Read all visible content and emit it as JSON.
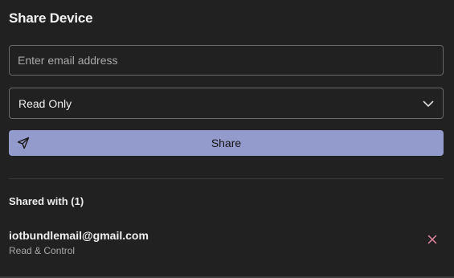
{
  "dialog": {
    "title": "Share Device"
  },
  "email_input": {
    "placeholder": "Enter email address",
    "value": ""
  },
  "permission_select": {
    "selected": "Read Only",
    "icon": "chevron-down-icon"
  },
  "share_button": {
    "label": "Share",
    "icon": "send-icon",
    "color": "#939bcd"
  },
  "shared_section": {
    "heading": "Shared with (1)",
    "items": [
      {
        "email": "iotbundlemail@gmail.com",
        "permission": "Read & Control",
        "remove_icon": "close-icon",
        "remove_color": "#e7869e"
      }
    ]
  }
}
